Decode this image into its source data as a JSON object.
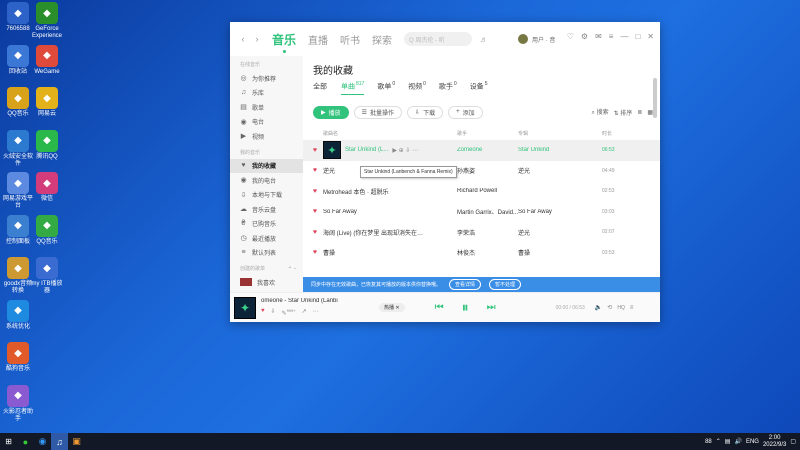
{
  "desktop": {
    "icons": [
      {
        "label": "7606588",
        "col": "a"
      },
      {
        "label": "GeForce Experience",
        "col": "b"
      },
      {
        "label": "回收站",
        "col": "a"
      },
      {
        "label": "WeGame",
        "col": "b"
      },
      {
        "label": "QQ音乐",
        "col": "a"
      },
      {
        "label": "网易云",
        "col": "b"
      },
      {
        "label": "火绒安全软件",
        "col": "a"
      },
      {
        "label": "腾讯QQ",
        "col": "b"
      },
      {
        "label": "网易游戏平台",
        "col": "a"
      },
      {
        "label": "微信",
        "col": "b"
      },
      {
        "label": "控制面板",
        "col": "a"
      },
      {
        "label": "QQ音乐",
        "col": "b"
      },
      {
        "label": "goodx音频转换",
        "col": "a"
      },
      {
        "label": "my ITB播放器",
        "col": "b"
      },
      {
        "label": "系统优化",
        "col": "a"
      },
      {
        "label": "酷狗音乐",
        "col": "a"
      },
      {
        "label": "火影忍者助手",
        "col": "a"
      }
    ]
  },
  "taskbar": {
    "lang": "ENG",
    "time": "2:00",
    "date": "2022/9/3",
    "tray_num": "88"
  },
  "app": {
    "nav": {
      "back": "‹",
      "forward": "›"
    },
    "top_tabs": [
      "音乐",
      "直播",
      "听书",
      "探索"
    ],
    "search_placeholder": "Q 周杰伦 - 听",
    "user_name": "用户 · 音",
    "sidebar": {
      "section1": "在线音乐",
      "items1": [
        {
          "label": "为你推荐",
          "icon": "◎"
        },
        {
          "label": "乐库",
          "icon": "♫"
        },
        {
          "label": "歌单",
          "icon": "▤"
        },
        {
          "label": "电台",
          "icon": "◉"
        },
        {
          "label": "视频",
          "icon": "▶"
        }
      ],
      "section2": "我的音乐",
      "items2": [
        {
          "label": "我的收藏",
          "icon": "♥",
          "active": true
        },
        {
          "label": "我的电台",
          "icon": "◉"
        },
        {
          "label": "本地与下载",
          "icon": "⇩"
        },
        {
          "label": "音乐云盘",
          "icon": "☁"
        },
        {
          "label": "已购音乐",
          "icon": "₴"
        },
        {
          "label": "最近播放",
          "icon": "◷"
        },
        {
          "label": "默认列表",
          "icon": "≡"
        }
      ],
      "section3": "创建的歌单",
      "playlist_hint": "我喜欢"
    },
    "page_title": "我的收藏",
    "subtabs": [
      {
        "label": "全部",
        "count": ""
      },
      {
        "label": "单曲",
        "count": "817",
        "active": true
      },
      {
        "label": "歌单",
        "count": "0"
      },
      {
        "label": "视频",
        "count": "0"
      },
      {
        "label": "歌手",
        "count": "0"
      },
      {
        "label": "设备",
        "count": "5"
      }
    ],
    "toolbar": {
      "play_all": "播放",
      "batch": "批量操作",
      "download": "下载",
      "add": "添加",
      "search": "搜索",
      "sort": "排序"
    },
    "table": {
      "headers": {
        "title": "歌曲名",
        "artist": "歌手",
        "album": "专辑",
        "duration": "时长"
      },
      "rows": [
        {
          "title": "Star Unkind (L...",
          "artist": "Zomeone",
          "album": "Star Unkind",
          "duration": "06:53",
          "thumb": true,
          "hl": true
        },
        {
          "title": "逆光",
          "artist": "孙燕姿",
          "album": "逆光",
          "duration": "04:49"
        },
        {
          "title": "Metrohead 本色 · 超脱乐",
          "artist": "Richard Powell",
          "album": "",
          "duration": "02:53"
        },
        {
          "title": "So Far Away",
          "artist": "Martin Garrix、David...",
          "album": "So Far Away",
          "duration": "03:03"
        },
        {
          "title": "海阔 (Live) (你在梦里 出现却消失在…",
          "artist": "李荣浩",
          "album": "逆光",
          "duration": "02:07"
        },
        {
          "title": "曹操",
          "artist": "林俊杰",
          "album": "曹操",
          "duration": "03:53"
        }
      ]
    },
    "tooltip": "Star Unkind (Lanbench & Fanna Remix)",
    "notice": {
      "text": "同步中存在无效歌曲，已恢复其可播放的版本供你替换哦。",
      "btn1": "查看详情",
      "btn2": "暂不处理"
    },
    "player": {
      "title": "omeone - Star Unkind (Lanbi",
      "time": "00:00 / 06:53",
      "like_count": "999+",
      "badge": "热播",
      "fx": "HQ",
      "quality": "标准"
    }
  }
}
